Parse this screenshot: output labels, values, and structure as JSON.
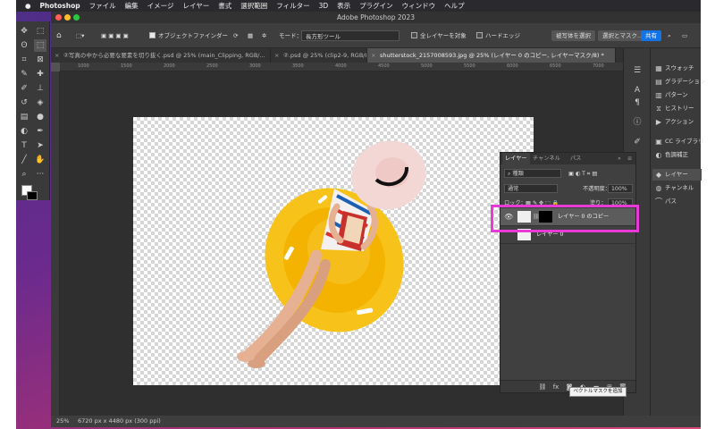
{
  "mac_menubar": {
    "apple": "",
    "app": "Photoshop",
    "items": [
      "ファイル",
      "編集",
      "イメージ",
      "レイヤー",
      "書式",
      "選択範囲",
      "フィルター",
      "3D",
      "表示",
      "プラグイン",
      "ウィンドウ",
      "ヘルプ"
    ]
  },
  "window": {
    "title": "Adobe Photoshop 2023"
  },
  "options_bar": {
    "object_finder": "オブジェクトファインダー",
    "mode_label": "モード：",
    "mode_value": "長方形ツール",
    "all_layers": "全レイヤーを対象",
    "hard_edge": "ハードエッジ",
    "select_subject": "被写体を選択",
    "select_mask": "選択とマスク...",
    "share": "共有"
  },
  "tabs": [
    {
      "label": "②写真の中から必要な要素を切り抜く.psd @ 25% (main_Clipping, RGB/..."
    },
    {
      "label": "②.psd @ 25% (clip2-9, RGB/8..."
    },
    {
      "label": "shutterstock_2157008593.jpg @ 25% (レイヤー 0 のコピー, レイヤーマスク/8) *"
    }
  ],
  "ruler_marks": [
    "1000",
    "1500",
    "2000",
    "2500",
    "3000",
    "3500",
    "4000",
    "4500",
    "5000",
    "5500",
    "6000",
    "6500",
    "7000"
  ],
  "status": {
    "zoom": "25%",
    "doc_size": "6720 px x 4480 px (300 ppi)"
  },
  "right_panel": {
    "items": [
      {
        "label": "スウォッチ",
        "icon": "grid-icon"
      },
      {
        "label": "グラデーション",
        "icon": "gradient-icon"
      },
      {
        "label": "パターン",
        "icon": "pattern-icon"
      },
      {
        "label": "ヒストリー",
        "icon": "history-icon"
      },
      {
        "label": "アクション",
        "icon": "play-icon"
      },
      {
        "label": "CC ライブラリ",
        "icon": "library-icon"
      },
      {
        "label": "色調補正",
        "icon": "adjust-icon"
      },
      {
        "label": "レイヤー",
        "icon": "layers-icon"
      },
      {
        "label": "チャンネル",
        "icon": "channels-icon"
      },
      {
        "label": "パス",
        "icon": "paths-icon"
      }
    ]
  },
  "layers_panel": {
    "tabs": [
      "レイヤー",
      "チャンネル",
      "パス"
    ],
    "kind": "種類",
    "blend_mode": "通常",
    "opacity_label": "不透明度：",
    "opacity_value": "100%",
    "lock_label": "ロック：",
    "fill_label": "塗り：",
    "fill_value": "100%",
    "layers": [
      {
        "name": "レイヤー 0 のコピー",
        "selected": true,
        "has_mask": true
      },
      {
        "name": "レイヤー 0",
        "selected": false,
        "has_mask": false
      }
    ],
    "tooltip": "ベクトルマスクを追加"
  },
  "colors": {
    "highlight": "#e83ad6",
    "accent": "#1473e6"
  }
}
